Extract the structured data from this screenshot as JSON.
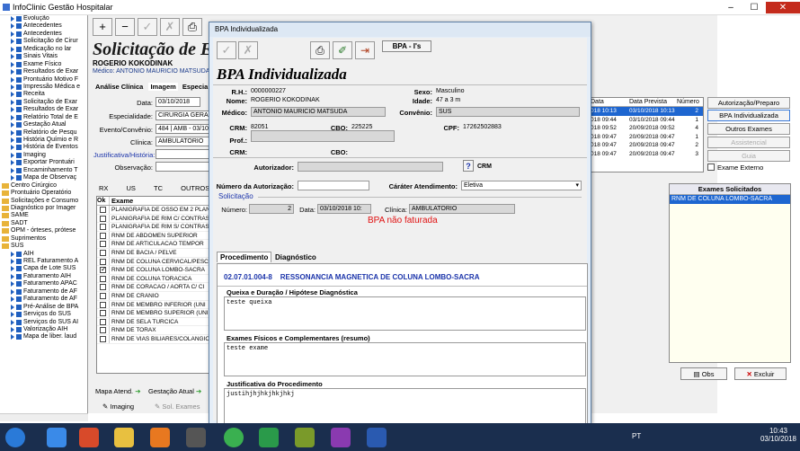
{
  "app": {
    "title": "InfoClinic Gestão Hospitalar"
  },
  "tree": [
    {
      "label": "Evolução",
      "lvl": 2
    },
    {
      "label": "Antecedentes",
      "lvl": 2
    },
    {
      "label": "Antecedentes",
      "lvl": 2
    },
    {
      "label": "Solicitação de Cirur",
      "lvl": 2
    },
    {
      "label": "Medicação no lar",
      "lvl": 2
    },
    {
      "label": "Sinais Vitais",
      "lvl": 2
    },
    {
      "label": "Exame Físico",
      "lvl": 2
    },
    {
      "label": "Resultados de Exar",
      "lvl": 2
    },
    {
      "label": "Prontuário Motivo F",
      "lvl": 2
    },
    {
      "label": "Impressão Médica e",
      "lvl": 2
    },
    {
      "label": "Receita",
      "lvl": 2
    },
    {
      "label": "Solicitação de Exar",
      "lvl": 2
    },
    {
      "label": "Resultados de Exar",
      "lvl": 2
    },
    {
      "label": "Relatório Total de E",
      "lvl": 2
    },
    {
      "label": "Gestação Atual",
      "lvl": 2
    },
    {
      "label": "Relatório de Pesqu",
      "lvl": 2
    },
    {
      "label": "História Químio e R",
      "lvl": 2
    },
    {
      "label": "História de Eventos",
      "lvl": 2
    },
    {
      "label": "Imaging",
      "lvl": 2
    },
    {
      "label": "Exportar Prontuári",
      "lvl": 2
    },
    {
      "label": "Encaminhamento T",
      "lvl": 2
    },
    {
      "label": "Mapa de Observaç",
      "lvl": 2
    },
    {
      "label": "Centro Cirúrgico",
      "lvl": 1
    },
    {
      "label": "Prontuário Operatório",
      "lvl": 1
    },
    {
      "label": "Solicitações e Consumo",
      "lvl": 1
    },
    {
      "label": "Diagnóstico por Imager",
      "lvl": 1
    },
    {
      "label": "SAME",
      "lvl": 1
    },
    {
      "label": "SADT",
      "lvl": 1
    },
    {
      "label": "OPM - órteses, prótese",
      "lvl": 1
    },
    {
      "label": "Suprimentos",
      "lvl": 1
    },
    {
      "label": "SUS",
      "lvl": 1
    },
    {
      "label": "AIH",
      "lvl": 2
    },
    {
      "label": "REL Faturamento A",
      "lvl": 2
    },
    {
      "label": "Capa de Lote SUS",
      "lvl": 2
    },
    {
      "label": "Faturamento AIH",
      "lvl": 2
    },
    {
      "label": "Faturamento APAC",
      "lvl": 2
    },
    {
      "label": "Faturamento de AF",
      "lvl": 2
    },
    {
      "label": "Faturamento de AF",
      "lvl": 2
    },
    {
      "label": "Pré-Análise de BPA",
      "lvl": 2
    },
    {
      "label": "Serviços do SUS",
      "lvl": 2
    },
    {
      "label": "Serviços do SUS AI",
      "lvl": 2
    },
    {
      "label": "Valorização AIH",
      "lvl": 2
    },
    {
      "label": "Mapa de liber. laud",
      "lvl": 2
    }
  ],
  "bg": {
    "title": "Solicitação de Ex",
    "patient": "ROGERIO KOKODINAK",
    "medico": "Médico:  ANTONIO MAURICIO MATSUDA",
    "tabs": [
      "Análise Clínica",
      "Imagem",
      "Especia"
    ],
    "data_lbl": "Data:",
    "data_val": "03/10/2018",
    "esp_lbl": "Especialidade:",
    "esp_val": "CIRURGIA GERAL",
    "evento_lbl": "Evento/Convênio:",
    "evento_val": "484 | AMB - 03/10/",
    "clinica_lbl": "Clínica:",
    "clinica_val": "AMBULATORIO",
    "just_lbl": "Justificativa/História:",
    "obs_lbl": "Observação:",
    "subtabs": [
      "RX",
      "US",
      "TC",
      "OUTROS (1)"
    ],
    "list_hdr_ok": "Ok",
    "list_hdr_exame": "Exame",
    "exams": [
      {
        "n": "PLANIGRAFIA DE OSSO EM 2 PLAN",
        "c": false
      },
      {
        "n": "PLANIGRAFIA DE RIM C/ CONTRAS",
        "c": false
      },
      {
        "n": "PLANIGRAFIA DE RIM S/ CONTRAS",
        "c": false
      },
      {
        "n": "RNM DE ABDOMEN SUPERIOR",
        "c": false
      },
      {
        "n": "RNM DE ARTICULACAO TEMPOR",
        "c": false
      },
      {
        "n": "RNM DE BACIA / PELVE",
        "c": false
      },
      {
        "n": "RNM DE COLUNA CERVICAL/PESC",
        "c": false
      },
      {
        "n": "RNM DE COLUNA LOMBO-SACRA",
        "c": true
      },
      {
        "n": "RNM DE COLUNA TORACICA",
        "c": false
      },
      {
        "n": "RNM DE CORACAO / AORTA C/ CI",
        "c": false
      },
      {
        "n": "RNM DE CRANIO",
        "c": false
      },
      {
        "n": "RNM DE MEMBRO INFERIOR (UNI",
        "c": false
      },
      {
        "n": "RNM DE MEMBRO SUPERIOR (UNI",
        "c": false
      },
      {
        "n": "RNM DE SELA TURCICA",
        "c": false
      },
      {
        "n": "RNM DE TORAX",
        "c": false
      },
      {
        "n": "RNM DE VIAS BILIARES/COLANGIO",
        "c": false
      }
    ],
    "grid_hdr": [
      "Data",
      "Data Prevista",
      "Número"
    ],
    "grid": [
      {
        "a": "018 10:13",
        "b": "03/10/2018 10:13",
        "n": "2",
        "sel": true
      },
      {
        "a": "018 09:44",
        "b": "03/10/2018 09:44",
        "n": "1",
        "sel": false
      },
      {
        "a": "018 09:52",
        "b": "20/09/2018 09:52",
        "n": "4",
        "sel": false
      },
      {
        "a": "018 09:47",
        "b": "20/09/2018 09:47",
        "n": "1",
        "sel": false
      },
      {
        "a": "018 09:47",
        "b": "20/09/2018 09:47",
        "n": "2",
        "sel": false
      },
      {
        "a": "018 09:47",
        "b": "20/09/2018 09:47",
        "n": "3",
        "sel": false
      }
    ],
    "rbtns": [
      "Autorização/Preparo",
      "BPA Individualizada",
      "Outros Exames",
      "Assistencial",
      "Guia"
    ],
    "exame_externo": "Exame Externo",
    "solicit_hdr": "Exames Solicitados",
    "solicit_item": "RNM  DE COLUNA LOMBO-SACRA",
    "obs_btn": "Obs",
    "excluir_btn": "Excluir",
    "bottom1": "Mapa Atend.",
    "bottom2": "Gestação Atual",
    "bottom3": "Imaging",
    "bottom4": "Sol. Exames"
  },
  "dlg": {
    "title": "BPA Individualizada",
    "bpa_btn": "BPA - I's",
    "heading": "BPA Individualizada",
    "rh_l": "R.H.:",
    "rh": "0000000227",
    "sexo_l": "Sexo:",
    "sexo": "Masculino",
    "nome_l": "Nome:",
    "nome": "ROGERIO KOKODINAK",
    "idade_l": "Idade:",
    "idade": "47 a 3 m",
    "med_l": "Médico:",
    "med": "ANTONIO MAURICIO MATSUDA",
    "conv_l": "Convênio:",
    "conv": "SUS",
    "crm_l": "CRM:",
    "crm": "82051",
    "cbo_l": "CBO:",
    "cbo": "225225",
    "cpf_l": "CPF:",
    "cpf": "17262502883",
    "prof_l": "Prof.:",
    "crm2_l": "CRM:",
    "cbo2_l": "CBO:",
    "autor_l": "Autorizador:",
    "crm_btn": "CRM",
    "numaut_l": "Número da Autorização:",
    "carater_l": "Cáráter Atendimento:",
    "carater": "Eletiva",
    "solic_legend": "Solicitação",
    "num_l": "Número:",
    "num": "2",
    "data_l": "Data:",
    "data": "03/10/2018 10:",
    "clin_l": "Clínica:",
    "clin": "AMBULATORIO",
    "status": "BPA não faturada",
    "tab1": "Procedimento",
    "tab2": "Diagnóstico",
    "proc": "02.07.01.004-8    RESSONANCIA MAGNETICA DE COLUNA LOMBO-SACRA",
    "q_l": "Queixa e Duração / Hipótese Diagnóstica",
    "q": "teste queixa",
    "e_l": "Exames Físicos e Complementares  (resumo)",
    "e": "teste exame",
    "j_l": "Justificativa do Procedimento",
    "j": "justihjhjhkjhkjhkj"
  },
  "tray": {
    "lang": "PT",
    "time": "10:43",
    "date": "03/10/2018"
  },
  "colors": {
    "accent": "#1e66d0",
    "status": "#e01010",
    "proc": "#1a33aa"
  }
}
